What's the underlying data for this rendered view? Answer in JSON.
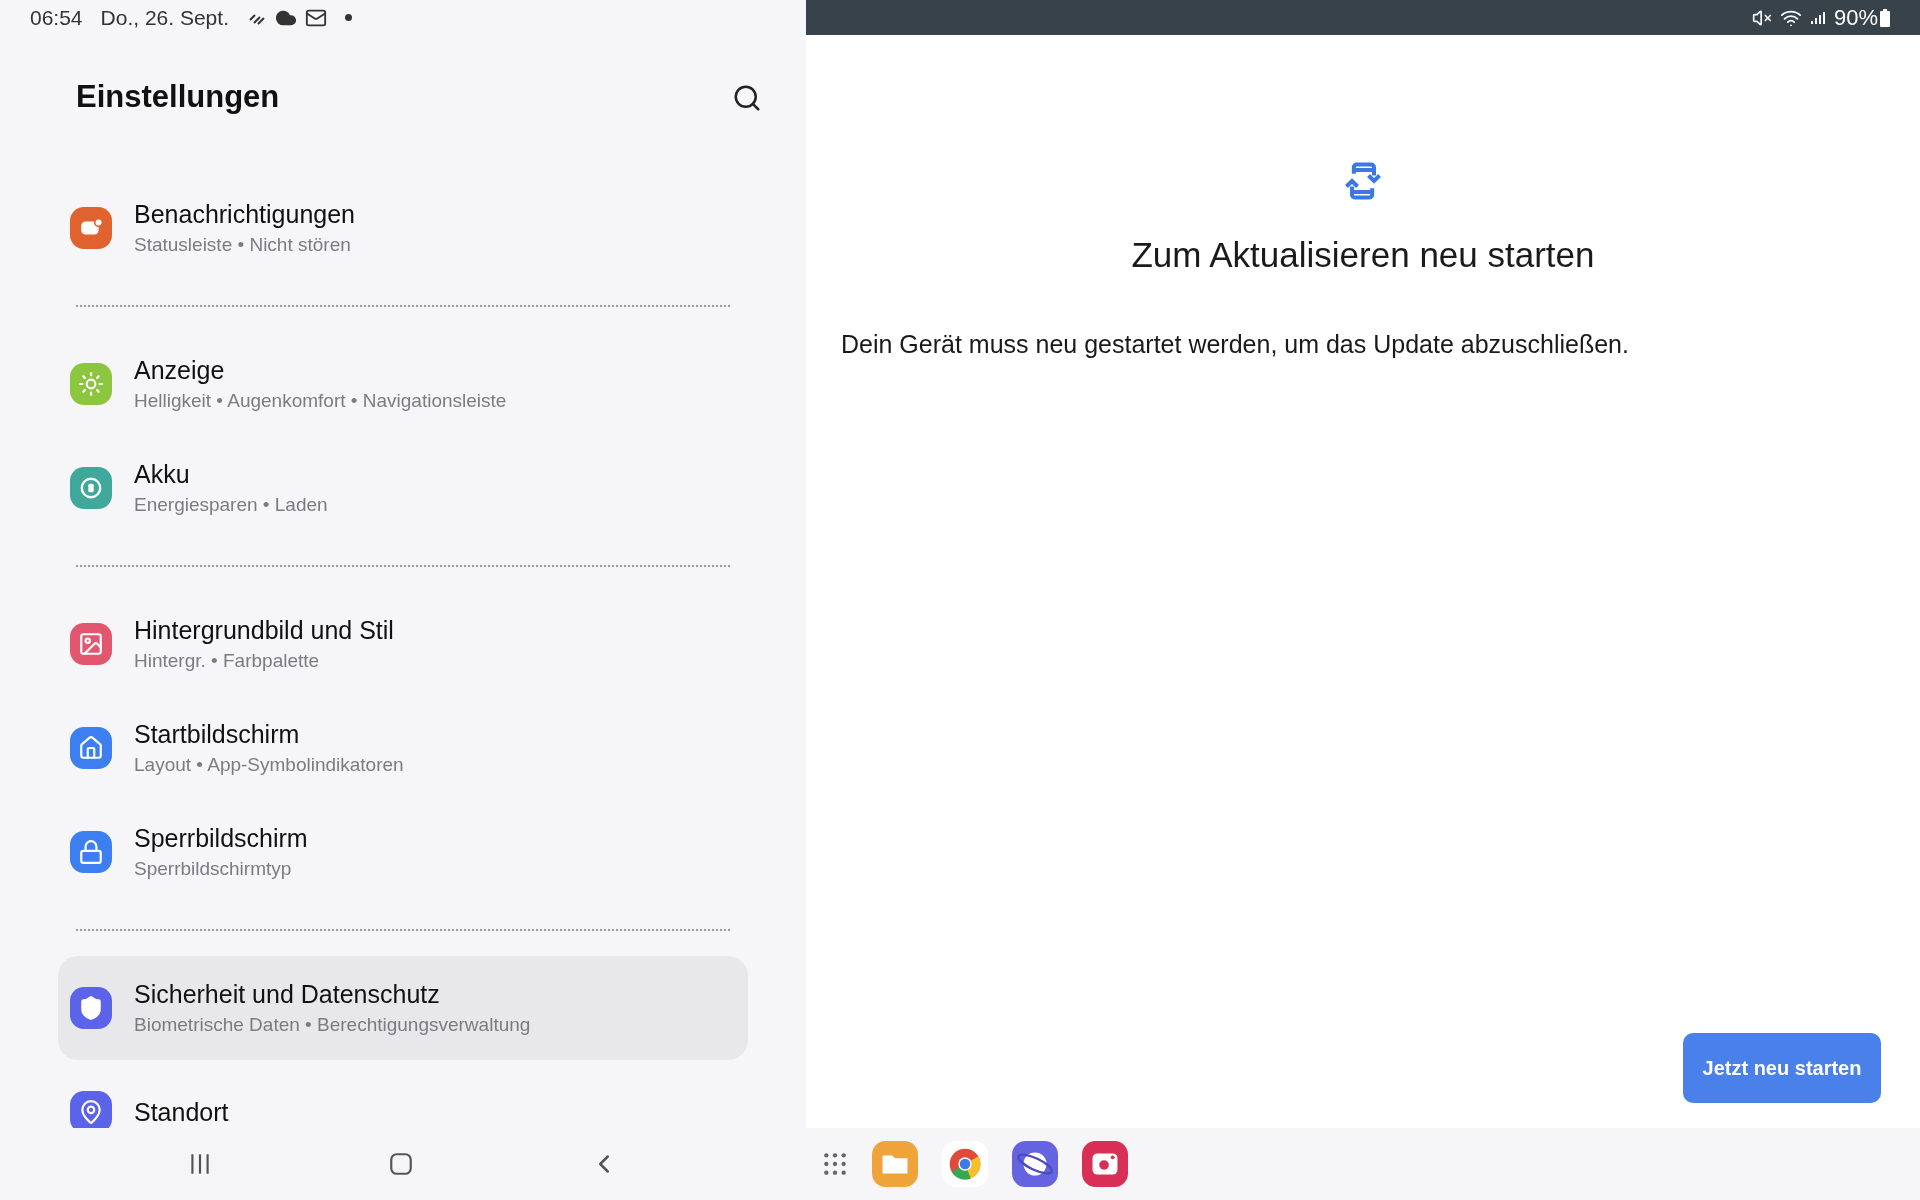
{
  "status_bar": {
    "time": "06:54",
    "date": "Do., 26. Sept.",
    "battery": "90%"
  },
  "settings": {
    "title": "Einstellungen",
    "groups": [
      {
        "items": [
          {
            "title": "Benachrichtigungen",
            "subtitle": "Statusleiste • Nicht stören",
            "color": "#e0622f",
            "selected": false
          }
        ]
      },
      {
        "items": [
          {
            "title": "Anzeige",
            "subtitle": "Helligkeit • Augenkomfort • Navigationsleiste",
            "color": "#8cc63f",
            "selected": false
          },
          {
            "title": "Akku",
            "subtitle": "Energiesparen • Laden",
            "color": "#3fa89a",
            "selected": false
          }
        ]
      },
      {
        "items": [
          {
            "title": "Hintergrundbild und Stil",
            "subtitle": "Hintergr. • Farbpalette",
            "color": "#e2566f",
            "selected": false
          },
          {
            "title": "Startbildschirm",
            "subtitle": "Layout • App-Symbolindikatoren",
            "color": "#3d7ff0",
            "selected": false
          },
          {
            "title": "Sperrbildschirm",
            "subtitle": "Sperrbildschirmtyp",
            "color": "#3d7ff0",
            "selected": false
          }
        ]
      },
      {
        "items": [
          {
            "title": "Sicherheit und Datenschutz",
            "subtitle": "Biometrische Daten • Berechtigungsverwaltung",
            "color": "#5b63e8",
            "selected": true
          },
          {
            "title": "Standort",
            "color": "#5b63e8",
            "selected": false
          }
        ]
      }
    ]
  },
  "update": {
    "title": "Zum Aktualisieren neu starten",
    "message": "Dein Gerät muss neu gestartet werden, um das Update abzuschließen.",
    "button": "Jetzt neu starten"
  }
}
